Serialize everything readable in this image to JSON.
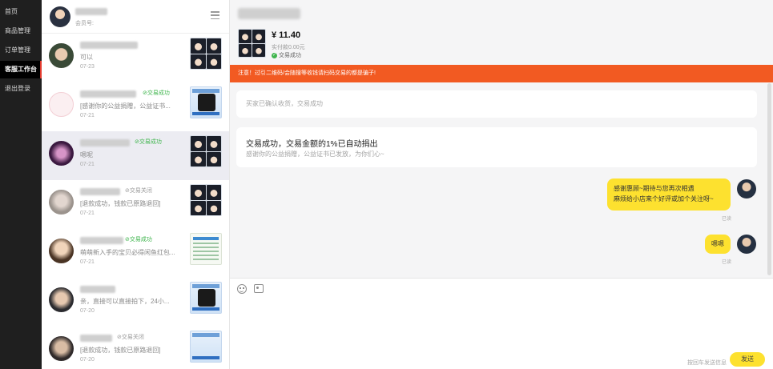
{
  "nav": {
    "items": [
      {
        "label": "首页"
      },
      {
        "label": "商品管理"
      },
      {
        "label": "订单管理"
      },
      {
        "label": "客服工作台"
      },
      {
        "label": "退出登录"
      }
    ],
    "active_index": 3
  },
  "sidebar_header": {
    "subtitle": "会员号:"
  },
  "conversations": [
    {
      "message": "可以",
      "date": "07-23",
      "status": "",
      "thumb": "faces"
    },
    {
      "message": "[感谢你的公益捐赠，公益证书...",
      "date": "07-21",
      "status": "交易成功",
      "thumb": "blue"
    },
    {
      "message": "嗯呢",
      "date": "07-21",
      "status": "交易成功",
      "thumb": "faces"
    },
    {
      "message": "[退款成功，钱款已原路退回]",
      "date": "07-21",
      "status": "交易关闭",
      "thumb": "faces"
    },
    {
      "message": "萌萌新入手的宝贝必得闲鱼红包...",
      "date": "07-21",
      "status": "交易成功",
      "thumb": "sheet"
    },
    {
      "message": "亲，直接可以直接拍下，24小...",
      "date": "07-20",
      "status": "",
      "thumb": "blue"
    },
    {
      "message": "[退款成功，钱款已原路退回]",
      "date": "07-20",
      "status": "交易关闭",
      "thumb": "blue"
    }
  ],
  "order": {
    "price": "¥ 11.40",
    "paid": "实付款0.00元",
    "status": "交易成功"
  },
  "warning": "注意！过引二维码/会随搜等收钱请扫码交易的都是骗子!",
  "system_messages": {
    "first": "买家已确认收货，交易成功",
    "second_title": "交易成功，交易金额的1%已自动捐出",
    "second_sub": "感谢你的公益捐赠，公益证书已发放，为你们心~"
  },
  "messages": [
    {
      "line1": "感谢惠顾~期待与您再次相遇",
      "line2": "麻烦给小店来个好评或加个关注呀~",
      "read": "已读"
    },
    {
      "text": "嗯嗯",
      "read": "已读"
    }
  ],
  "composer": {
    "hint": "按回车发送信息",
    "send_label": "发送"
  },
  "colors": {
    "accent": "#fde12f",
    "warning": "#f25a22",
    "success": "#3fb54d",
    "nav_bg": "#1f1f1f"
  }
}
